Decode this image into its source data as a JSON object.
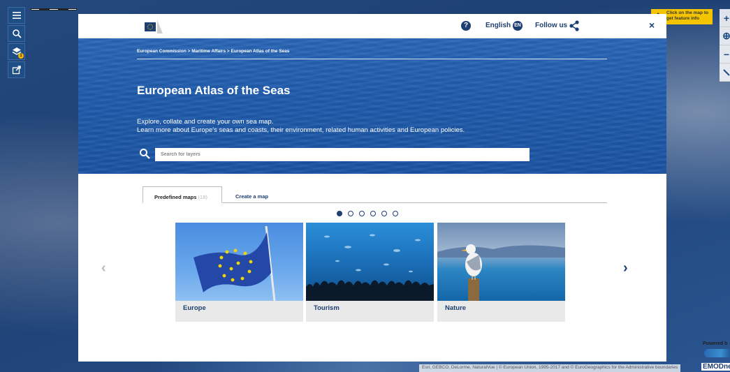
{
  "map": {
    "info_tip": "Click on the map to get feature info",
    "powered_by": "Powered b",
    "attribution": "Esri, GEBCO, DeLorme, NaturalVue | © European Union, 1995-2017 and © EuroGeographics for the Administrative boundaries",
    "emodnet": "EMODne",
    "left_toolbar": [
      "menu-icon",
      "search-icon",
      "layers-icon",
      "share-icon"
    ],
    "right_toolbar": {
      "zoom_in": "+",
      "locate": "⊕",
      "zoom_out": "−"
    }
  },
  "header": {
    "help": "?",
    "language": "English",
    "language_code": "EN",
    "follow": "Follow us",
    "close": "×"
  },
  "hero": {
    "breadcrumb": "European Commission > Maritime Affairs > European Atlas of the Seas",
    "title": "European Atlas of the Seas",
    "desc_line1": "Explore, collate and create your own sea map.",
    "desc_line2": "Learn more about Europe's seas and coasts, their environment, related human activities and European policies.",
    "search_placeholder": "Search for layers"
  },
  "tabs": {
    "predefined": "Predefined maps",
    "predefined_count": "(18)",
    "create": "Create a map"
  },
  "carousel": {
    "pages": 6,
    "active_page": 1,
    "prev": "‹",
    "next": "›",
    "cards": [
      {
        "label": "Europe"
      },
      {
        "label": "Tourism"
      },
      {
        "label": "Nature"
      }
    ]
  },
  "colors": {
    "brand": "#1d3f72",
    "hero": "#1f5cad",
    "highlight": "#f5c400"
  }
}
